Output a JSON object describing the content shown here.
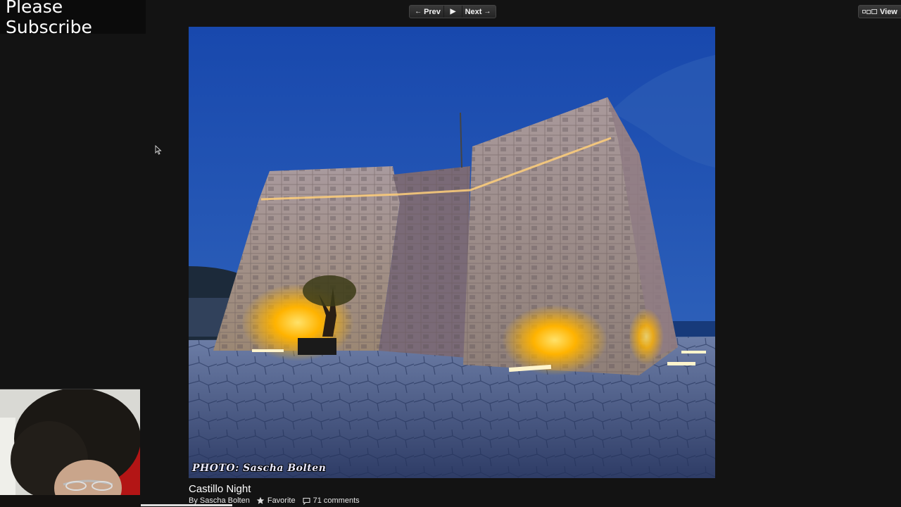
{
  "overlay": {
    "subscribe_text": "Please Subscribe"
  },
  "nav": {
    "prev_label": "Prev",
    "next_label": "Next",
    "view_label": "View"
  },
  "photo": {
    "title": "Castillo Night",
    "watermark": "PHOTO: Sascha Bolten",
    "byline": "By Sascha Bolten",
    "favorite_label": "Favorite",
    "comments_label": "71 comments"
  },
  "icons": {
    "prev": "arrow-left-icon",
    "play": "play-icon",
    "next": "arrow-right-icon",
    "view": "view-layout-icon",
    "favorite": "star-icon",
    "comments": "comment-icon",
    "cursor": "mouse-pointer-icon"
  },
  "colors": {
    "background": "#131313",
    "sky": "#1d4aa6",
    "light": "#ffb300"
  }
}
